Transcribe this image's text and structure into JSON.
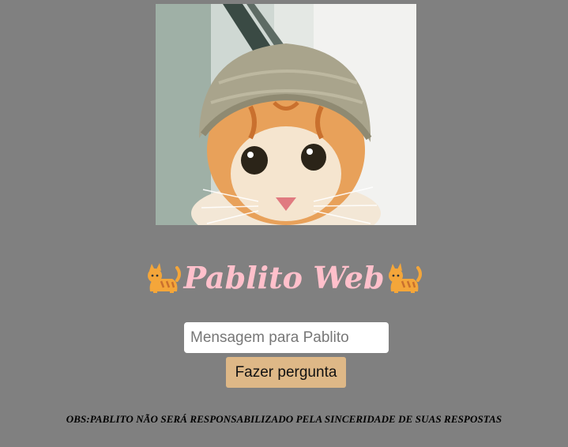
{
  "header": {
    "image": {
      "icon": "cat-with-knit-hat-photo"
    }
  },
  "title": {
    "text": "Pablito Web",
    "color": "#ffc0cb",
    "left_icon": "cat-emoji-icon",
    "right_icon": "cat-emoji-icon"
  },
  "form": {
    "message_placeholder": "Mensagem para Pablito",
    "message_value": "",
    "ask_button_label": "Fazer pergunta",
    "ask_button_color": "#deb887"
  },
  "footer": {
    "notice": "OBS:PABLITO NÃO SERÁ RESPONSABILIZADO PELA SINCERIDADE DE SUAS RESPOSTAS"
  },
  "colors": {
    "background": "#808080"
  }
}
